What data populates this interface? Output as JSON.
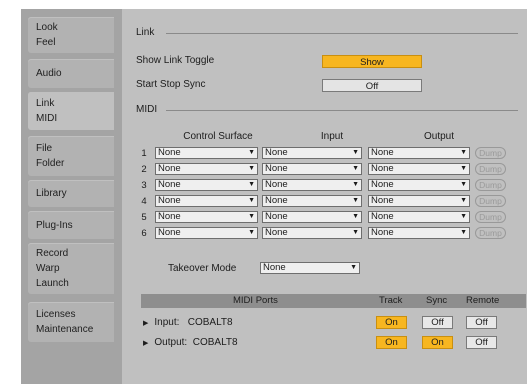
{
  "sidebar": {
    "tabs": [
      {
        "lines": [
          "Look",
          "Feel"
        ]
      },
      {
        "lines": [
          "Audio"
        ]
      },
      {
        "lines": [
          "Link",
          "MIDI"
        ]
      },
      {
        "lines": [
          "File",
          "Folder"
        ]
      },
      {
        "lines": [
          "Library"
        ]
      },
      {
        "lines": [
          "Plug-Ins"
        ]
      },
      {
        "lines": [
          "Record",
          "Warp",
          "Launch"
        ]
      },
      {
        "lines": [
          "Licenses",
          "Maintenance"
        ]
      }
    ]
  },
  "link": {
    "section_title": "Link",
    "show_link_toggle_label": "Show Link Toggle",
    "show_link_toggle_value": "Show",
    "start_stop_sync_label": "Start Stop Sync",
    "start_stop_sync_value": "Off"
  },
  "midi": {
    "section_title": "MIDI",
    "columns": {
      "control_surface": "Control Surface",
      "input": "Input",
      "output": "Output"
    },
    "rows": [
      {
        "num": "1",
        "control_surface": "None",
        "input": "None",
        "output": "None",
        "dump": "Dump"
      },
      {
        "num": "2",
        "control_surface": "None",
        "input": "None",
        "output": "None",
        "dump": "Dump"
      },
      {
        "num": "3",
        "control_surface": "None",
        "input": "None",
        "output": "None",
        "dump": "Dump"
      },
      {
        "num": "4",
        "control_surface": "None",
        "input": "None",
        "output": "None",
        "dump": "Dump"
      },
      {
        "num": "5",
        "control_surface": "None",
        "input": "None",
        "output": "None",
        "dump": "Dump"
      },
      {
        "num": "6",
        "control_surface": "None",
        "input": "None",
        "output": "None",
        "dump": "Dump"
      }
    ],
    "takeover_mode_label": "Takeover Mode",
    "takeover_mode_value": "None"
  },
  "ports": {
    "header": {
      "midi_ports": "MIDI Ports",
      "track": "Track",
      "sync": "Sync",
      "remote": "Remote"
    },
    "rows": [
      {
        "label": "Input:   COBALT8",
        "track": "On",
        "sync": "Off",
        "remote": "Off",
        "track_on": true,
        "sync_on": false,
        "remote_on": false
      },
      {
        "label": "Output:  COBALT8",
        "track": "On",
        "sync": "On",
        "remote": "Off",
        "track_on": true,
        "sync_on": true,
        "remote_on": false
      }
    ]
  },
  "colors": {
    "accent_on": "#f7b620",
    "panel": "#c0c0c0",
    "sidebar": "#a4a4a4"
  }
}
